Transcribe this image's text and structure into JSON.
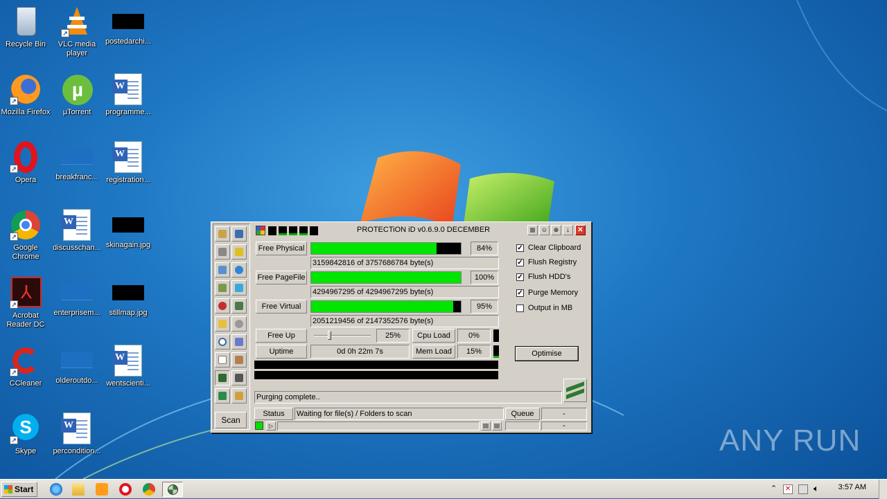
{
  "desktop": {
    "icons": [
      {
        "label": "Recycle Bin"
      },
      {
        "label": "VLC media player"
      },
      {
        "label": "postedarchi..."
      },
      {
        "label": "Mozilla Firefox"
      },
      {
        "label": "µTorrent"
      },
      {
        "label": "programme..."
      },
      {
        "label": "Opera"
      },
      {
        "label": "breakfranc..."
      },
      {
        "label": "registration..."
      },
      {
        "label": "Google Chrome"
      },
      {
        "label": "discusschan..."
      },
      {
        "label": "skinagain.jpg"
      },
      {
        "label": "Acrobat Reader DC"
      },
      {
        "label": "enterprisem..."
      },
      {
        "label": "stillmap.jpg"
      },
      {
        "label": "CCleaner"
      },
      {
        "label": "olderoutdo..."
      },
      {
        "label": "wentscienti..."
      },
      {
        "label": "Skype"
      },
      {
        "label": "percondition..."
      }
    ],
    "watermark": "ANY RUN"
  },
  "app": {
    "title": "PROTECTiON iD v0.6.9.0 DECEMBER",
    "rows": {
      "physical": {
        "label": "Free Physical",
        "percent_text": "84%",
        "fill": 0.84,
        "bytes": "3159842816 of 3757686784 byte(s)"
      },
      "pagefile": {
        "label": "Free PageFile",
        "percent_text": "100%",
        "fill": 1.0,
        "bytes": "4294967295 of 4294967295 byte(s)"
      },
      "virtual": {
        "label": "Free Virtual",
        "percent_text": "95%",
        "fill": 0.95,
        "bytes": "2051219456 of 2147352576 byte(s)"
      }
    },
    "freeup": {
      "label": "Free Up",
      "value": "25%",
      "slider_fraction": 0.25
    },
    "cpu": {
      "label": "Cpu Load",
      "value": "0%"
    },
    "uptime": {
      "label": "Uptime",
      "value": "0d 0h 22m 7s"
    },
    "mem": {
      "label": "Mem Load",
      "value": "15%"
    },
    "options": [
      {
        "label": "Clear Clipboard",
        "checked": true
      },
      {
        "label": "Flush Registry",
        "checked": true
      },
      {
        "label": "Flush HDD's",
        "checked": true
      },
      {
        "label": "Purge Memory",
        "checked": true
      },
      {
        "label": "Output in MB",
        "checked": false
      }
    ],
    "optimise_label": "Optimise",
    "status_message": "Purging complete..",
    "scan_label": "Scan",
    "status_label": "Status",
    "status_text": "Waiting for file(s) / Folders to scan",
    "queue_label": "Queue",
    "queue_value": "-",
    "queue_value2": "-"
  },
  "taskbar": {
    "start_label": "Start",
    "clock": "3:57 AM"
  }
}
